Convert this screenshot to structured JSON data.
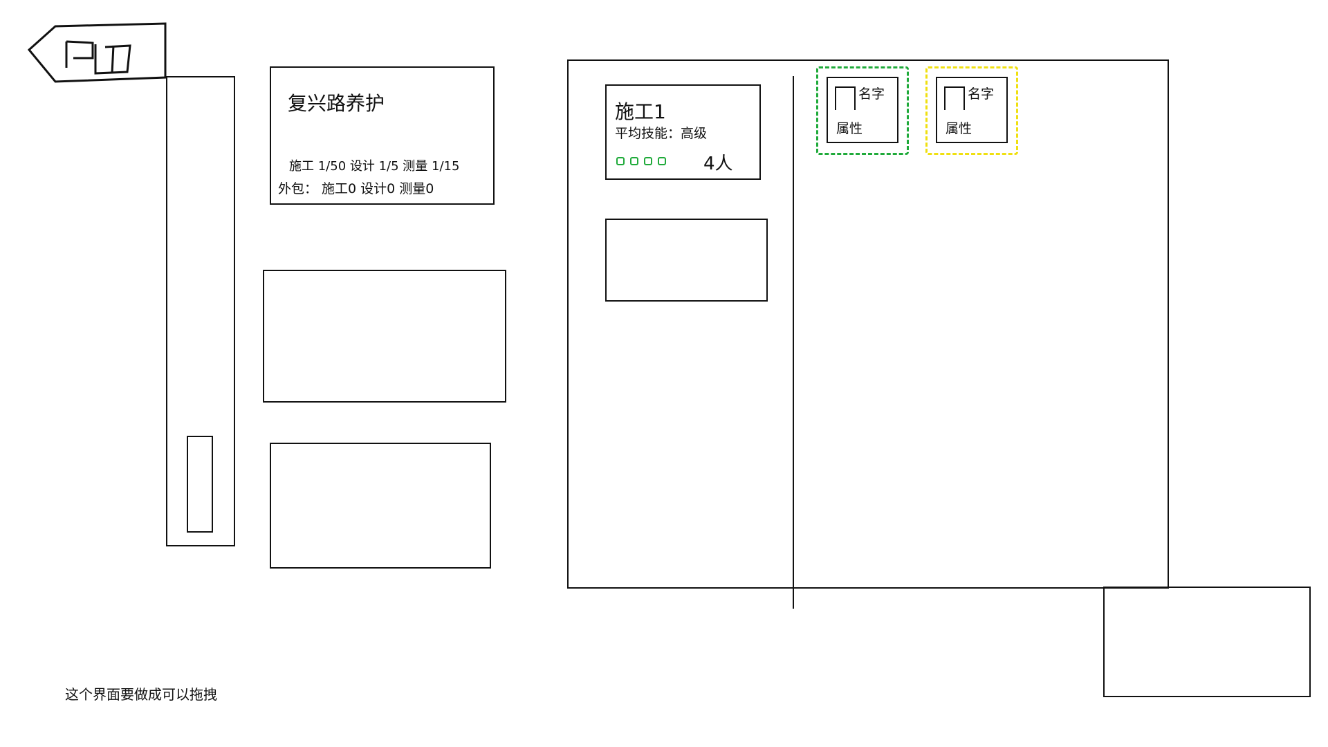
{
  "project": {
    "title": "复兴路养护",
    "staff_line": "施工 1/50 设计 1/5 测量 1/15",
    "outsource_line": "外包：  施工0 设计0 测量0"
  },
  "team": {
    "name": "施工1",
    "avg_skill": "平均技能：高级",
    "member_count": "4人",
    "skill_dot_count": 4
  },
  "members": [
    {
      "name": "名字",
      "attr": "属性",
      "frame_color": "#1faa3a"
    },
    {
      "name": "名字",
      "attr": "属性",
      "frame_color": "#f0e010"
    }
  ],
  "footer_note": "这个界面要做成可以拖拽",
  "colors": {
    "ink": "#111111",
    "green": "#1faa3a",
    "yellow": "#f0e010"
  },
  "icons": {
    "back": "back-tag-icon"
  }
}
